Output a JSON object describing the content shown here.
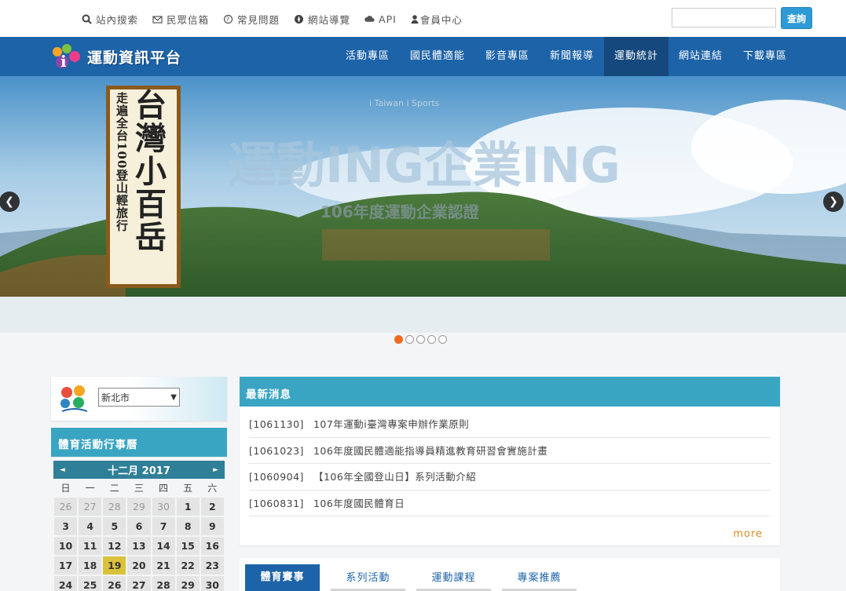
{
  "toplinks": [
    {
      "label": "站內搜索",
      "icon": "search-icon"
    },
    {
      "label": "民眾信箱",
      "icon": "envelope-icon"
    },
    {
      "label": "常見問題",
      "icon": "question-icon"
    },
    {
      "label": "網站導覽",
      "icon": "compass-icon"
    },
    {
      "label": "API",
      "icon": "cloud-icon"
    },
    {
      "label": "會員中心",
      "icon": "user-icon"
    }
  ],
  "search": {
    "placeholder": "",
    "button": "查詢"
  },
  "site": {
    "logo_text": "運動資訊平台",
    "logo_prefix": "i"
  },
  "nav": [
    {
      "label": "活動專區",
      "active": false
    },
    {
      "label": "國民體適能",
      "active": false
    },
    {
      "label": "影音專區",
      "active": false
    },
    {
      "label": "新聞報導",
      "active": false
    },
    {
      "label": "運動統計",
      "active": true
    },
    {
      "label": "網站連結",
      "active": false
    },
    {
      "label": "下載專區",
      "active": false
    }
  ],
  "banner": {
    "title": "台灣小百岳",
    "subtitle": "走遍全台100登山輕旅行",
    "headline_left": "運動ING",
    "headline_right": "企業ING",
    "tagline": "106年度運動企業認證",
    "badge": "i Taiwan i Sports",
    "slides": 5,
    "current_slide": 1
  },
  "sidebar": {
    "city_selected": "新北市",
    "calendar_title": "體育活動行事曆",
    "month_label": "十二月 2017",
    "weekdays": [
      "日",
      "一",
      "二",
      "三",
      "四",
      "五",
      "六"
    ],
    "weeks": [
      [
        {
          "d": "26",
          "o": true
        },
        {
          "d": "27",
          "o": true
        },
        {
          "d": "28",
          "o": true
        },
        {
          "d": "29",
          "o": true
        },
        {
          "d": "30",
          "o": true
        },
        {
          "d": "1"
        },
        {
          "d": "2"
        }
      ],
      [
        {
          "d": "3"
        },
        {
          "d": "4"
        },
        {
          "d": "5"
        },
        {
          "d": "6"
        },
        {
          "d": "7"
        },
        {
          "d": "8"
        },
        {
          "d": "9"
        }
      ],
      [
        {
          "d": "10"
        },
        {
          "d": "11"
        },
        {
          "d": "12"
        },
        {
          "d": "13"
        },
        {
          "d": "14"
        },
        {
          "d": "15"
        },
        {
          "d": "16"
        }
      ],
      [
        {
          "d": "17"
        },
        {
          "d": "18"
        },
        {
          "d": "19",
          "t": true
        },
        {
          "d": "20"
        },
        {
          "d": "21"
        },
        {
          "d": "22"
        },
        {
          "d": "23"
        }
      ],
      [
        {
          "d": "24"
        },
        {
          "d": "25"
        },
        {
          "d": "26"
        },
        {
          "d": "27"
        },
        {
          "d": "28"
        },
        {
          "d": "29"
        },
        {
          "d": "30"
        }
      ]
    ]
  },
  "news": {
    "title": "最新消息",
    "items": [
      {
        "date": "[1061130]",
        "text": "107年運動i臺灣專案申辦作業原則"
      },
      {
        "date": "[1061023]",
        "text": "106年度國民體適能指導員精進教育研習會實施計畫"
      },
      {
        "date": "[1060904]",
        "text": "【106年全國登山日】系列活動介紹"
      },
      {
        "date": "[1060831]",
        "text": "106年度國民體育日"
      }
    ],
    "more": "more"
  },
  "tabs": [
    {
      "label": "體育賽事",
      "active": true
    },
    {
      "label": "系列活動",
      "active": false
    },
    {
      "label": "運動課程",
      "active": false
    },
    {
      "label": "專案推薦",
      "active": false
    }
  ],
  "colors": {
    "nav": "#1d63a8",
    "accent": "#3aa5c2",
    "today": "#d9c23a",
    "active_dot": "#f06a1f"
  }
}
